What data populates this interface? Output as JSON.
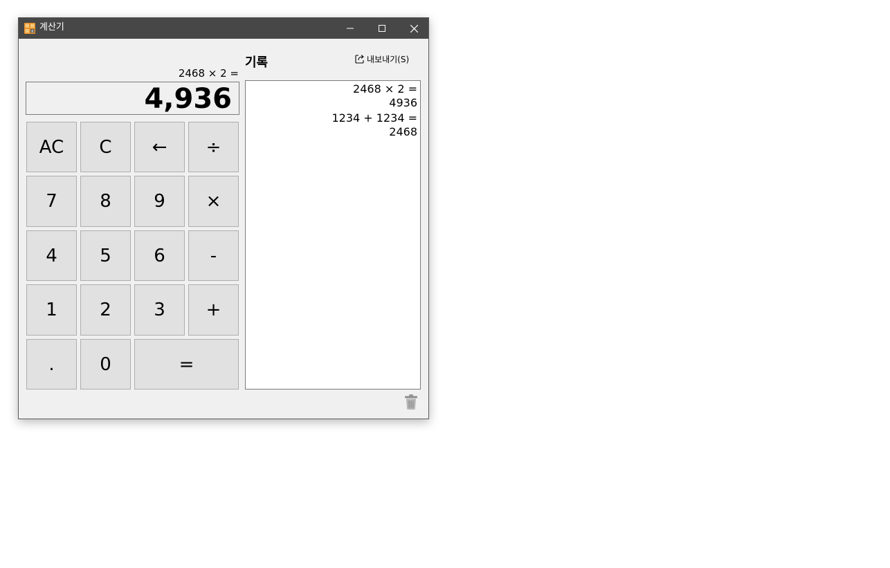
{
  "window": {
    "title": "계산기"
  },
  "calculator": {
    "expression": "2468 × 2 =",
    "display": "4,936",
    "keys": [
      {
        "id": "all-clear",
        "label": "AC"
      },
      {
        "id": "clear",
        "label": "C"
      },
      {
        "id": "backspace",
        "label": "←"
      },
      {
        "id": "divide",
        "label": "÷"
      },
      {
        "id": "digit-7",
        "label": "7"
      },
      {
        "id": "digit-8",
        "label": "8"
      },
      {
        "id": "digit-9",
        "label": "9"
      },
      {
        "id": "multiply",
        "label": "×"
      },
      {
        "id": "digit-4",
        "label": "4"
      },
      {
        "id": "digit-5",
        "label": "5"
      },
      {
        "id": "digit-6",
        "label": "6"
      },
      {
        "id": "subtract",
        "label": "-"
      },
      {
        "id": "digit-1",
        "label": "1"
      },
      {
        "id": "digit-2",
        "label": "2"
      },
      {
        "id": "digit-3",
        "label": "3"
      },
      {
        "id": "add",
        "label": "+"
      },
      {
        "id": "decimal",
        "label": "."
      },
      {
        "id": "digit-0",
        "label": "0"
      },
      {
        "id": "equals",
        "label": "="
      }
    ]
  },
  "history": {
    "title": "기록",
    "export_label": "내보내기(S)",
    "entries": [
      {
        "expression": "2468 × 2 =",
        "result": "4936"
      },
      {
        "expression": "1234 + 1234 =",
        "result": "2468"
      }
    ]
  },
  "icons": {
    "app": "calculator-app-icon",
    "minimize": "minimize-icon",
    "maximize": "maximize-icon",
    "close": "close-icon",
    "export": "export-icon",
    "delete": "trash-icon"
  },
  "colors": {
    "titlebar": "#474747",
    "window_bg": "#f0f0f0",
    "key_bg": "#e1e1e1",
    "key_border": "#adadad"
  }
}
